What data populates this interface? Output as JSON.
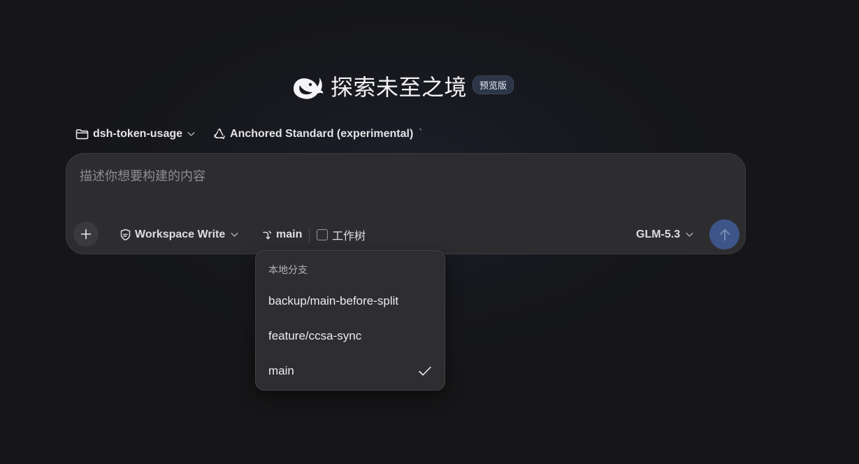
{
  "hero": {
    "title": "探索未至之境",
    "badge": "预览版",
    "logo_icon": "whale-logo-icon"
  },
  "context": {
    "folder": {
      "label": "dsh-token-usage",
      "icon": "folder-icon"
    },
    "mode": {
      "label": "Anchored Standard (experimental)",
      "icon": "recycle-icon",
      "trailing_char": "`"
    }
  },
  "composer": {
    "placeholder": "描述你想要构建的内容",
    "value": "",
    "permission": {
      "label": "Workspace Write",
      "icon": "shield-icon"
    },
    "branch": {
      "label": "main",
      "icon": "git-branch-icon"
    },
    "worktree": {
      "label": "工作树",
      "checked": false
    },
    "model": {
      "label": "GLM-5.3"
    },
    "send_icon": "arrow-up-icon"
  },
  "branch_dropdown": {
    "header": "本地分支",
    "items": [
      {
        "label": "backup/main-before-split",
        "selected": false
      },
      {
        "label": "feature/ccsa-sync",
        "selected": false
      },
      {
        "label": "main",
        "selected": true
      }
    ]
  },
  "colors": {
    "background": "#161618",
    "composer_bg": "#2d2d30",
    "accent_send": "#3d5589",
    "badge_bg": "#2d3548"
  }
}
